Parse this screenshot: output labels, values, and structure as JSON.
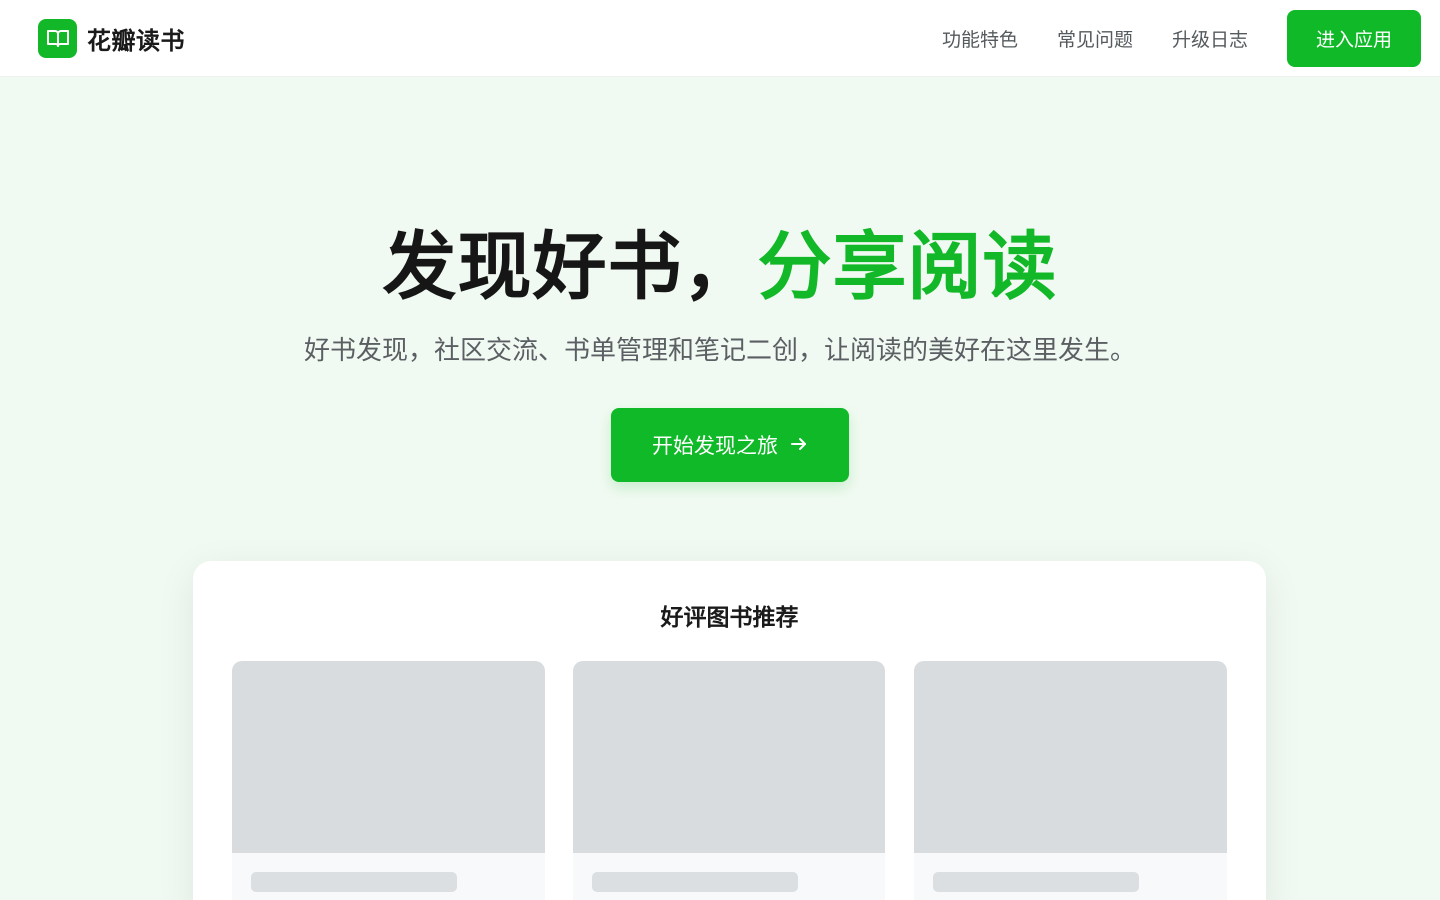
{
  "header": {
    "brand_name": "花瓣读书",
    "logo_icon": "book-open-icon",
    "nav": [
      {
        "label": "功能特色"
      },
      {
        "label": "常见问题"
      },
      {
        "label": "升级日志"
      }
    ],
    "enter_label": "进入应用"
  },
  "hero": {
    "title_main": "发现好书，",
    "title_accent": "分享阅读",
    "subtitle": "好书发现，社区交流、书单管理和笔记二创，让阅读的美好在这里发生。",
    "cta_label": "开始发现之旅",
    "cta_icon": "arrow-right-icon"
  },
  "recommendations": {
    "title": "好评图书推荐",
    "items_loading": 3
  },
  "colors": {
    "brand_green": "#10b928",
    "background": "#f1faf2",
    "skeleton": "#d9dcdf"
  }
}
